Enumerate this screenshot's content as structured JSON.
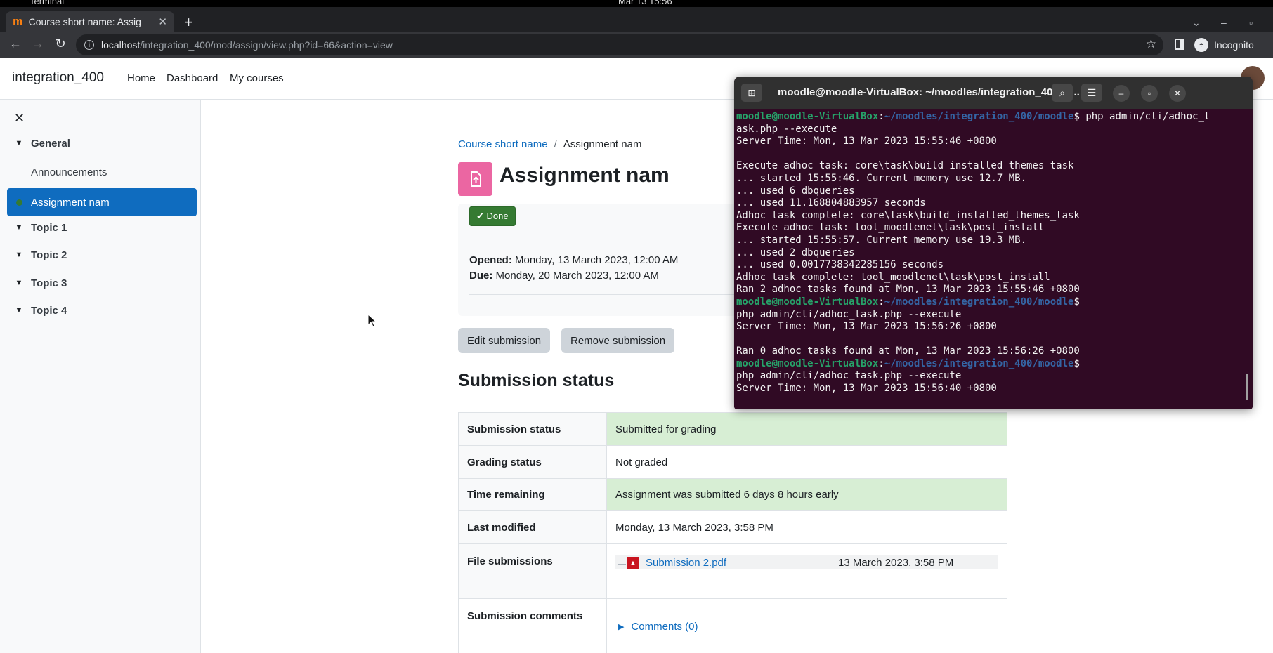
{
  "os": {
    "app": "Terminal",
    "clock": "Mar 13 15:56"
  },
  "browser": {
    "tab_title": "Course short name: Assig",
    "favicon": "m",
    "url_host": "localhost",
    "url_path": "/integration_400/mod/assign/view.php?id=66&action=view",
    "profile_label": "Incognito"
  },
  "navbar": {
    "site_name": "integration_400",
    "links": [
      "Home",
      "Dashboard",
      "My courses"
    ]
  },
  "course_index": {
    "sections": [
      {
        "label": "General"
      },
      {
        "label": "Announcements"
      },
      {
        "label": "Assignment nam"
      },
      {
        "label": "Topic 1"
      },
      {
        "label": "Topic 2"
      },
      {
        "label": "Topic 3"
      },
      {
        "label": "Topic 4"
      }
    ]
  },
  "main": {
    "breadcrumb": {
      "parent": "Course short name",
      "separator": "/",
      "current": "Assignment nam"
    },
    "title": "Assignment nam",
    "completion_label": "✔ Done",
    "dates": {
      "opened_label": "Opened:",
      "opened_value": "Monday, 13 March 2023, 12:00 AM",
      "due_label": "Due:",
      "due_value": "Monday, 20 March 2023, 12:00 AM"
    },
    "buttons": {
      "edit": "Edit submission",
      "remove": "Remove submission"
    },
    "section_heading": "Submission status",
    "status_rows": [
      {
        "label": "Submission status",
        "value": "Submitted for grading",
        "highlight": true
      },
      {
        "label": "Grading status",
        "value": "Not graded",
        "highlight": false
      },
      {
        "label": "Time remaining",
        "value": "Assignment was submitted 6 days 8 hours early",
        "highlight": true
      },
      {
        "label": "Last modified",
        "value": "Monday, 13 March 2023, 3:58 PM",
        "highlight": false
      },
      {
        "label": "File submissions",
        "file_name": "Submission 2.pdf",
        "file_date": "13 March 2023, 3:58 PM"
      },
      {
        "label": "Submission comments",
        "value": "Comments (0)"
      }
    ]
  },
  "terminal": {
    "title": "moodle@moodle-VirtualBox: ~/moodles/integration_400/m...",
    "user_host": "moodle@moodle-VirtualBox",
    "path": "~/moodles/integration_400/moodle",
    "lines": {
      "cmd1a": " php admin/cli/adhoc_t",
      "cmd1b": "ask.php --execute",
      "l3": "Server Time: Mon, 13 Mar 2023 15:55:46 +0800",
      "l4": "",
      "l5": "Execute adhoc task: core\\task\\build_installed_themes_task",
      "l6": "... started 15:55:46. Current memory use 12.7 MB.",
      "l7": "... used 6 dbqueries",
      "l8": "... used 11.168804883957 seconds",
      "l9": "Adhoc task complete: core\\task\\build_installed_themes_task",
      "l10": "Execute adhoc task: tool_moodlenet\\task\\post_install",
      "l11": "... started 15:55:57. Current memory use 19.3 MB.",
      "l12": "... used 2 dbqueries",
      "l13": "... used 0.0017738342285156 seconds",
      "l14": "Adhoc task complete: tool_moodlenet\\task\\post_install",
      "l15": "Ran 2 adhoc tasks found at Mon, 13 Mar 2023 15:55:46 +0800",
      "cmd2": "php admin/cli/adhoc_task.php --execute",
      "l18": "Server Time: Mon, 13 Mar 2023 15:56:26 +0800",
      "l19": "",
      "l20": "Ran 0 adhoc tasks found at Mon, 13 Mar 2023 15:56:26 +0800",
      "cmd3": "php admin/cli/adhoc_task.php --execute",
      "l23": "Server Time: Mon, 13 Mar 2023 15:56:40 +0800"
    },
    "prompt_suffix": "$"
  },
  "colors": {
    "brand": "#0f6cbf",
    "done_green": "#357a32",
    "status_green": "#d7eed4",
    "assign_pink": "#eb66a2",
    "terminal_bg": "#300a24"
  }
}
